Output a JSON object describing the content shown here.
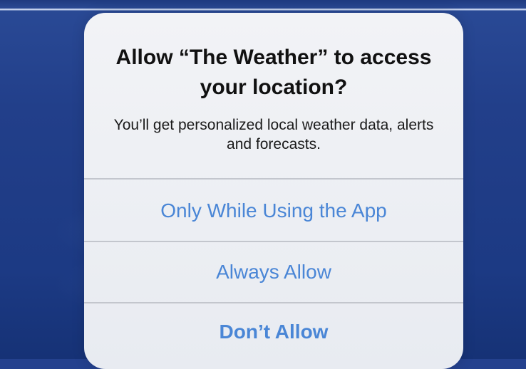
{
  "dialog": {
    "title": "Allow “The Weather” to access your location?",
    "message": "You’ll get personalized local weather data, alerts and forecasts.",
    "buttons": {
      "while_using": "Only While Using the App",
      "always": "Always Allow",
      "deny": "Don’t Allow"
    }
  },
  "colors": {
    "button_text": "#4a86d6",
    "backdrop": "#24418e",
    "dialog_bg": "#f0f2f5"
  }
}
